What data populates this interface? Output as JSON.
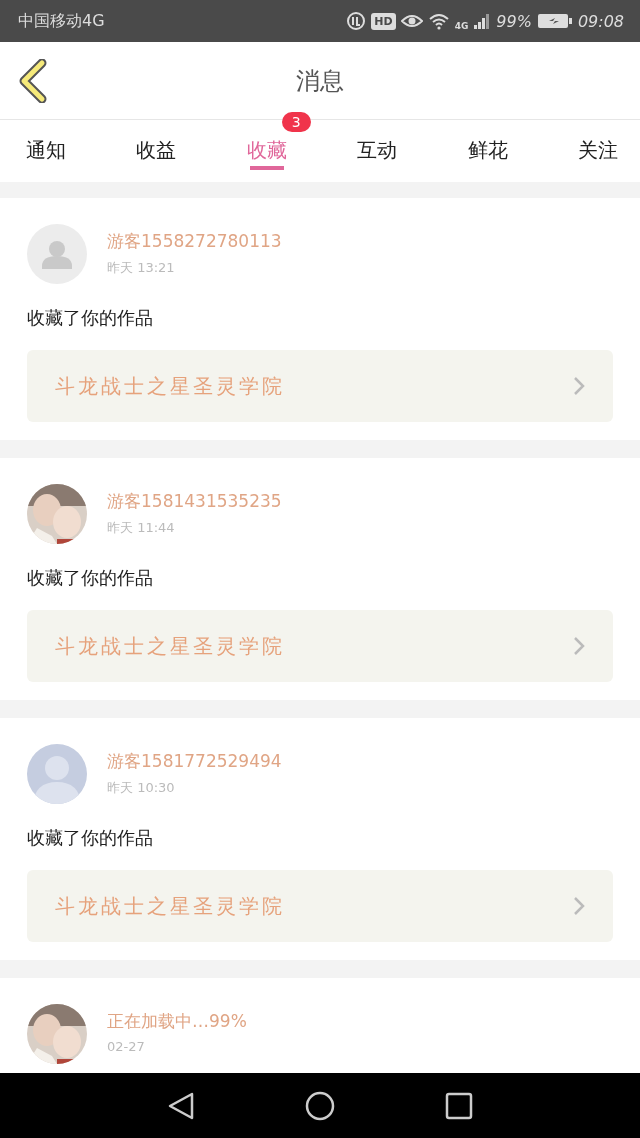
{
  "status_bar": {
    "carrier": "中国移动4G",
    "hd": "HD",
    "network": "4G",
    "battery": "99%",
    "time": "09:08"
  },
  "header": {
    "title": "消息"
  },
  "tabs": [
    {
      "label": "通知",
      "selected": false
    },
    {
      "label": "收益",
      "selected": false
    },
    {
      "label": "收藏",
      "selected": true,
      "badge": "3"
    },
    {
      "label": "互动",
      "selected": false
    },
    {
      "label": "鲜花",
      "selected": false
    },
    {
      "label": "关注",
      "selected": false
    }
  ],
  "messages": [
    {
      "avatar": {
        "kind": "placeholder"
      },
      "name": "游客1558272780113",
      "time": "昨天 13:21",
      "text": "收藏了你的作品",
      "work": "斗龙战士之星圣灵学院"
    },
    {
      "name": "游客1581431535235",
      "time": "昨天 11:44",
      "text": "收藏了你的作品",
      "work": "斗龙战士之星圣灵学院"
    },
    {
      "avatar": {
        "kind": "silhouette"
      },
      "name": "游客1581772529494",
      "time": "昨天 10:30",
      "text": "收藏了你的作品",
      "work": "斗龙战士之星圣灵学院"
    },
    {
      "name": "正在加载中…99%",
      "time": "02-27"
    }
  ]
}
